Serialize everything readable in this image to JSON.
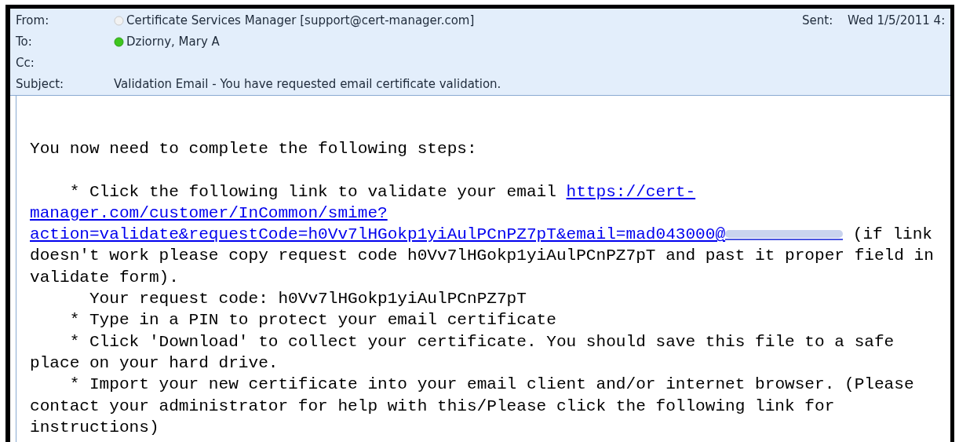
{
  "header": {
    "fields": [
      {
        "label": "From:",
        "value": "Certificate Services Manager [support@cert-manager.com]",
        "online": false
      },
      {
        "label": "To:",
        "value": "Dziorny, Mary A",
        "online": true
      },
      {
        "label": "Cc:"
      },
      {
        "label": "Subject:",
        "value": "Validation Email - You have requested email certificate validation."
      }
    ],
    "sent": {
      "label": "Sent:",
      "value": "Wed 1/5/2011 4:"
    }
  },
  "body": {
    "blocks": [
      {
        "kind": "text",
        "text": "You now need to complete the following steps:"
      },
      {
        "kind": "blank"
      },
      {
        "kind": "link_para",
        "before": "    * Click the following link to validate your email ",
        "link_lines": [
          "https://cert-",
          "manager.com/customer/InCommon/smime?",
          "action=validate&requestCode=h0Vv7lHGokp1yiAulPCnPZ7pT&email=mad043000@"
        ],
        "redacted": true,
        "after": " (if link doesn't work please copy request code h0Vv7lHGokp1yiAulPCnPZ7pT and past it proper field in validate form)."
      },
      {
        "kind": "text",
        "text": "      Your request code: h0Vv7lHGokp1yiAulPCnPZ7pT"
      },
      {
        "kind": "text",
        "text": "    * Type in a PIN to protect your email certificate"
      },
      {
        "kind": "text",
        "text": "    * Click 'Download' to collect your certificate. You should save this file to a safe place on your hard drive."
      },
      {
        "kind": "text",
        "text": "    * Import your new certificate into your email client and/or internet browser. (Please contact your administrator for help with this/Please click the following link for instructions)"
      }
    ]
  }
}
